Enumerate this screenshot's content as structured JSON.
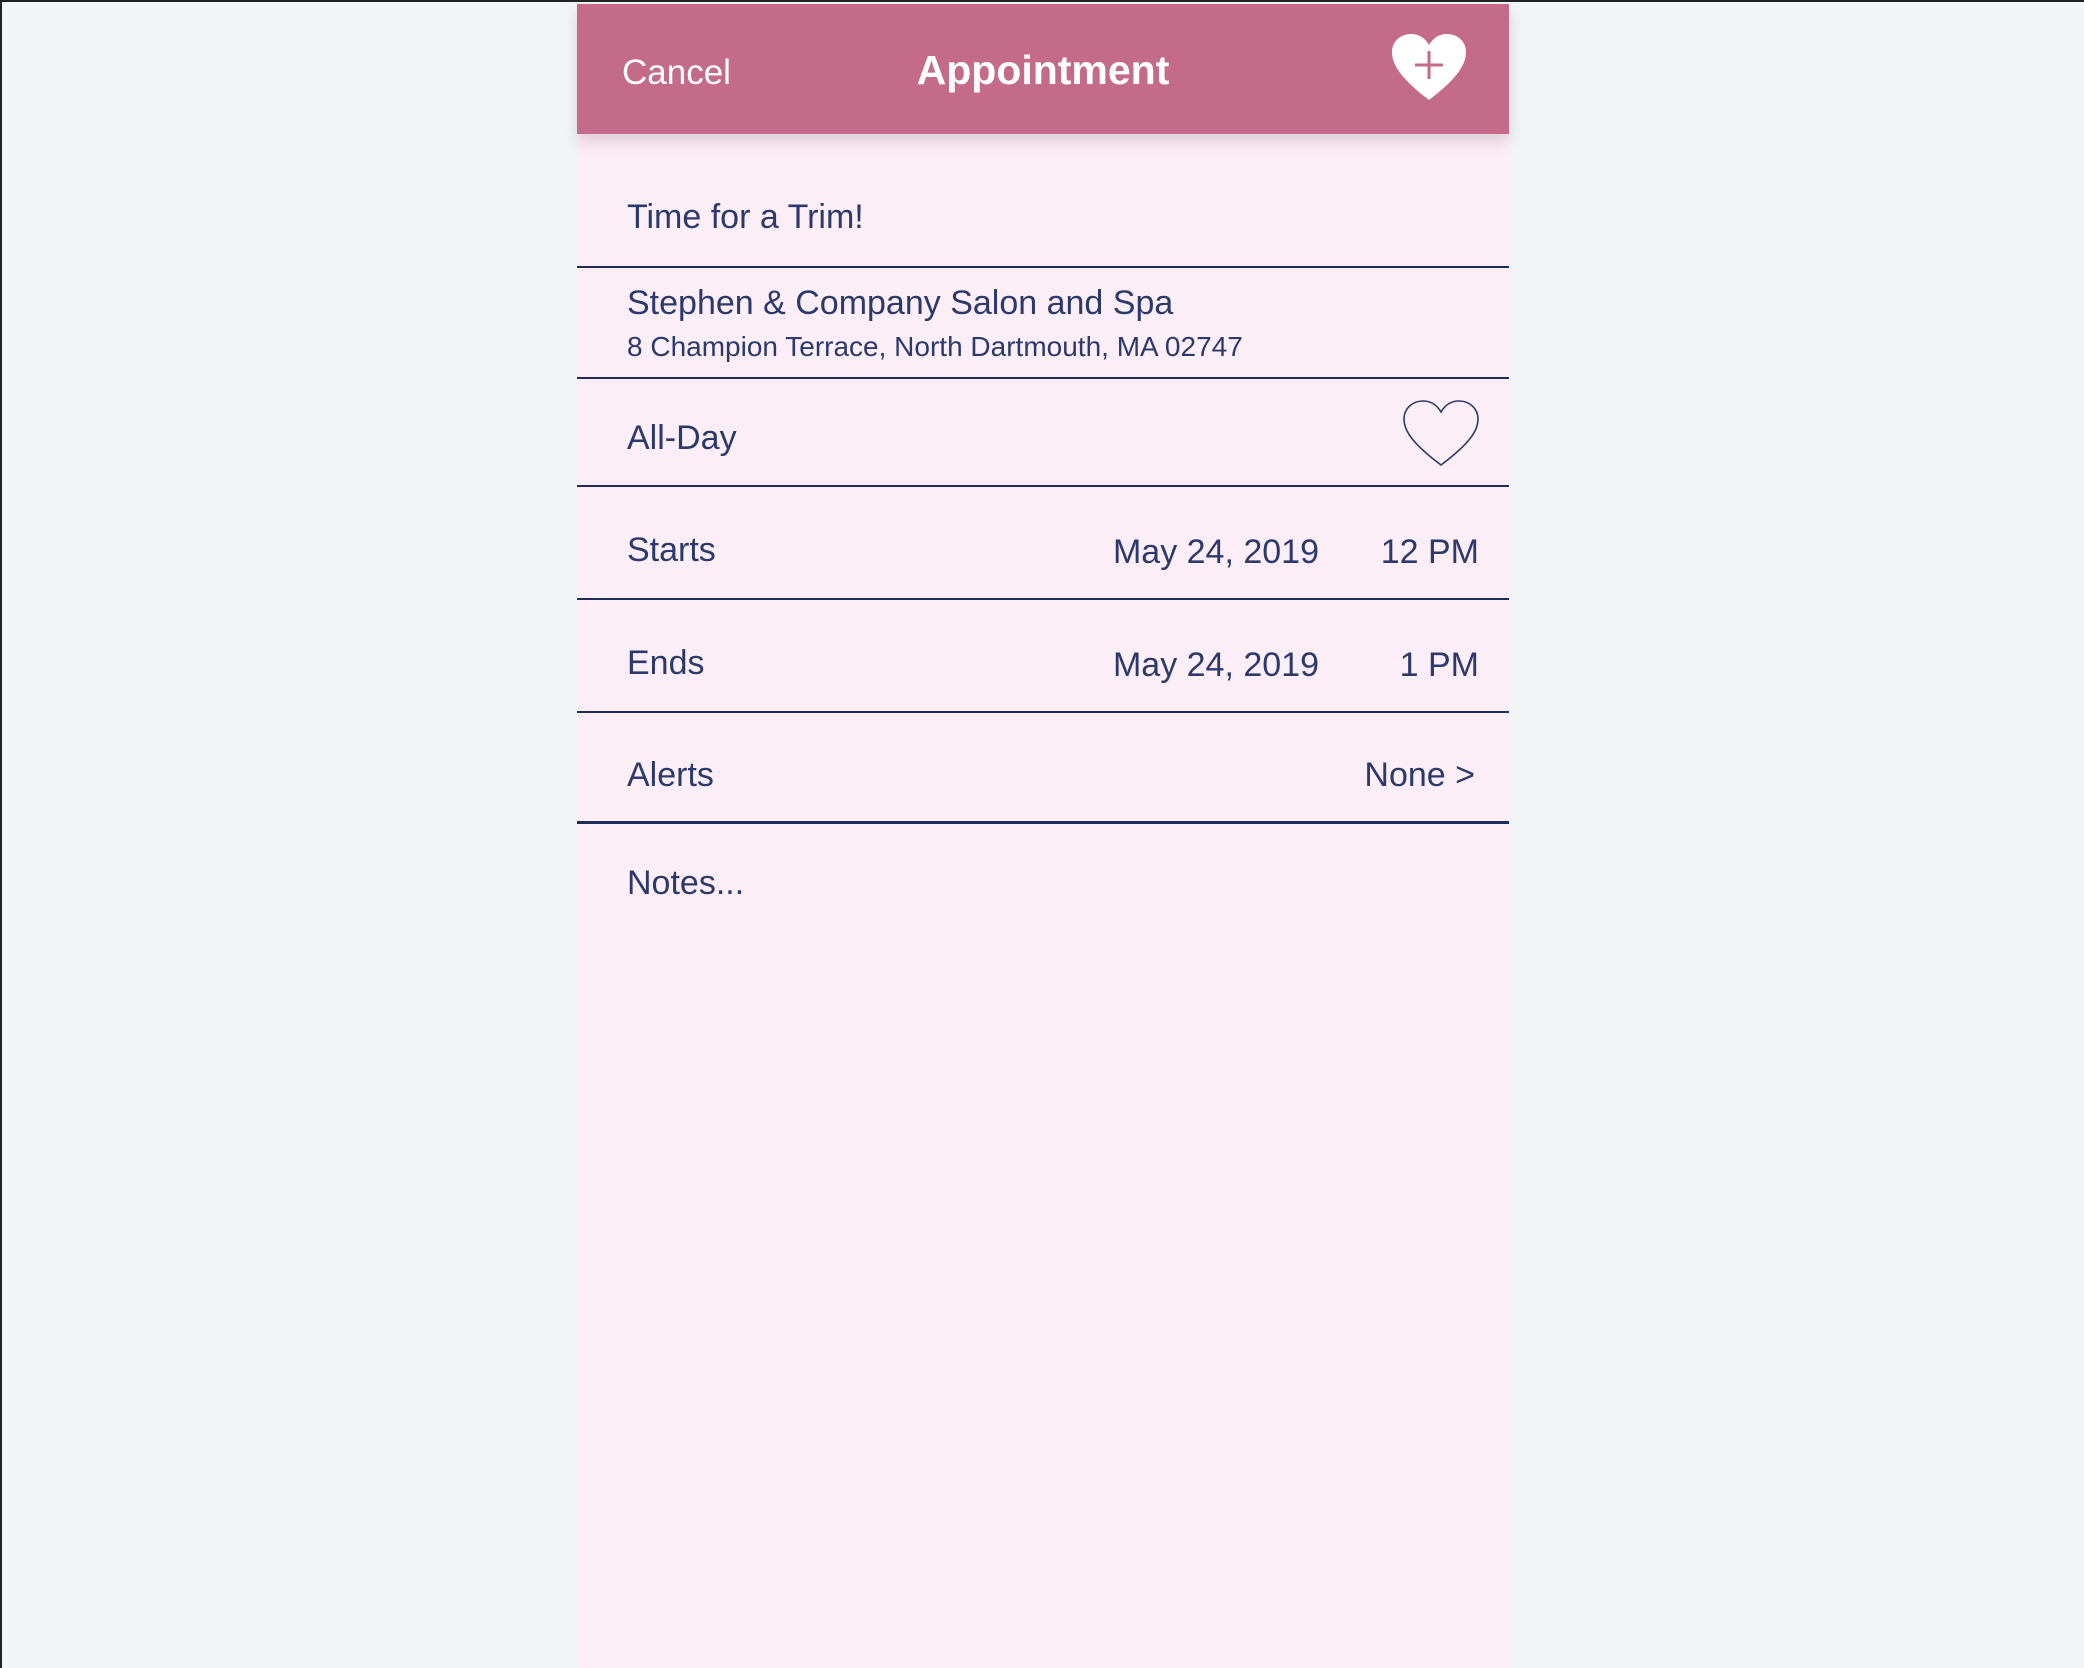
{
  "nav": {
    "cancel_label": "Cancel",
    "title": "Appointment",
    "add_icon": "heart-plus-icon"
  },
  "event": {
    "title": "Time for a Trim!",
    "location_name": "Stephen & Company Salon and Spa",
    "location_address": "8 Champion Terrace, North Dartmouth, MA 02747"
  },
  "all_day": {
    "label": "All-Day",
    "icon": "heart-outline-icon",
    "enabled": false
  },
  "starts": {
    "label": "Starts",
    "date": "May 24, 2019",
    "time": "12 PM"
  },
  "ends": {
    "label": "Ends",
    "date": "May 24, 2019",
    "time": "1 PM"
  },
  "alerts": {
    "label": "Alerts",
    "value": "None >"
  },
  "notes": {
    "placeholder": "Notes..."
  },
  "colors": {
    "nav_background": "#c36b89",
    "page_background": "#fbeef6",
    "text": "#2b3a6b",
    "outer_background": "#f1f5f6"
  }
}
